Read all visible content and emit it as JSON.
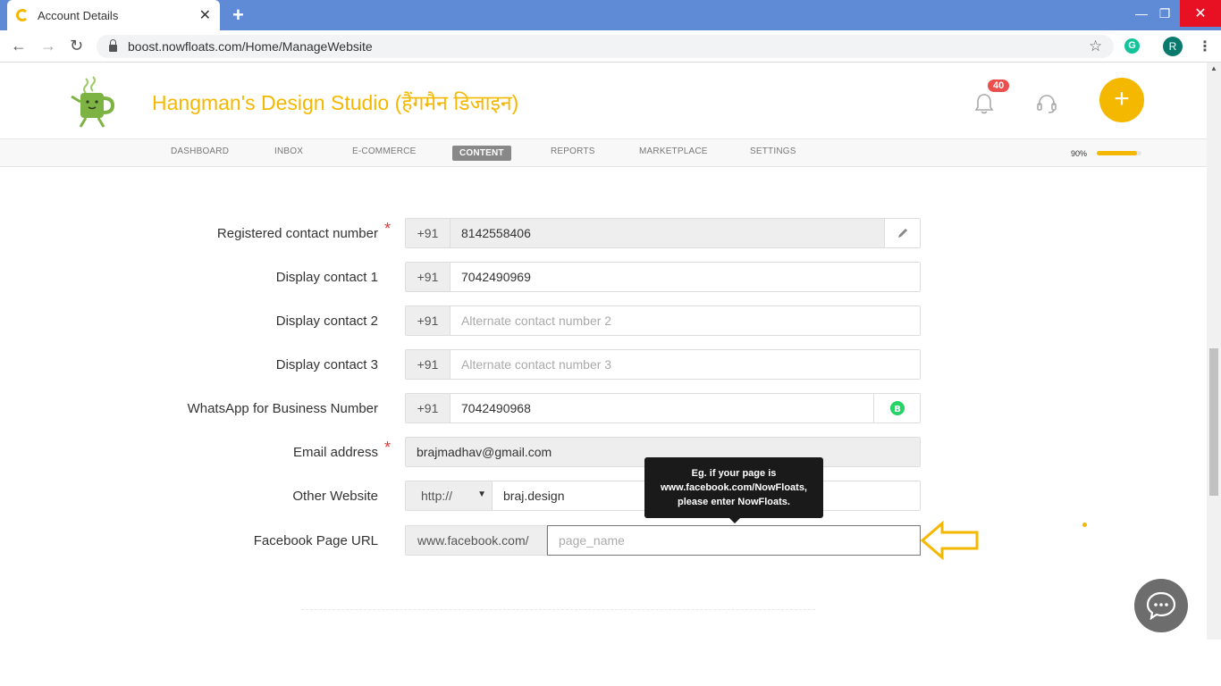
{
  "browser": {
    "tab_title": "Account Details",
    "url": "boost.nowfloats.com/Home/ManageWebsite",
    "profile_initial": "R"
  },
  "header": {
    "brand": "Hangman's Design Studio (हैंगमैन डिजाइन)",
    "notification_count": "40"
  },
  "nav": {
    "items": [
      "DASHBOARD",
      "INBOX",
      "E-COMMERCE",
      "CONTENT",
      "REPORTS",
      "MARKETPLACE",
      "SETTINGS"
    ],
    "active": "CONTENT",
    "progress_label": "90%",
    "progress_value": 0.9
  },
  "form": {
    "registered": {
      "label": "Registered contact number",
      "code": "+91",
      "value": "8142558406"
    },
    "display1": {
      "label": "Display contact 1",
      "code": "+91",
      "value": "7042490969"
    },
    "display2": {
      "label": "Display contact 2",
      "code": "+91",
      "placeholder": "Alternate contact number 2"
    },
    "display3": {
      "label": "Display contact 3",
      "code": "+91",
      "placeholder": "Alternate contact number 3"
    },
    "whatsapp": {
      "label": "WhatsApp for Business Number",
      "code": "+91",
      "value": "7042490968"
    },
    "email": {
      "label": "Email address",
      "value": "brajmadhav@gmail.com"
    },
    "website": {
      "label": "Other Website",
      "protocol": "http://",
      "value": "braj.design"
    },
    "facebook": {
      "label": "Facebook Page URL",
      "prefix": "www.facebook.com/",
      "placeholder": "page_name"
    }
  },
  "tooltip": {
    "line1": "Eg. if your page is",
    "line2": "www.facebook.com/NowFloats,",
    "line3": "please enter NowFloats."
  },
  "colors": {
    "accent": "#f5b800",
    "required": "#e53935",
    "tab_bar": "#5f8ad6"
  }
}
